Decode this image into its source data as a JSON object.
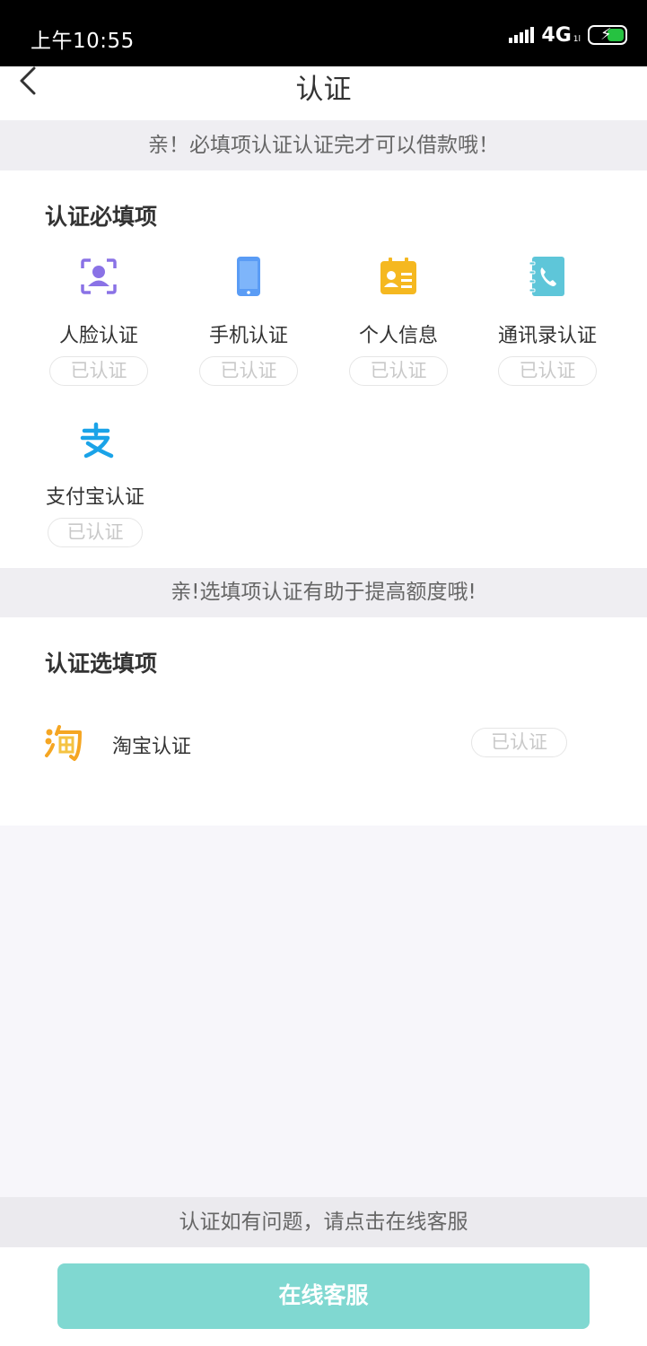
{
  "status_bar": {
    "time": "上午10:55",
    "network": "4G",
    "network_sub": "1l",
    "battery_color": "#26c241"
  },
  "navbar": {
    "title": "认证",
    "back_icon": "chevron-left-icon"
  },
  "required": {
    "banner": "亲！必填项认证认证完才可以借款哦！",
    "title": "认证必填项",
    "items": [
      {
        "label": "人脸认证",
        "status": "已认证",
        "icon": "face-id-icon",
        "color": "#8a72e6"
      },
      {
        "label": "手机认证",
        "status": "已认证",
        "icon": "phone-icon",
        "color": "#5a9cf5"
      },
      {
        "label": "个人信息",
        "status": "已认证",
        "icon": "id-card-icon",
        "color": "#f5b820"
      },
      {
        "label": "通讯录认证",
        "status": "已认证",
        "icon": "contacts-phone-icon",
        "color": "#5ec6d9"
      },
      {
        "label": "支付宝认证",
        "status": "已认证",
        "icon": "alipay-icon",
        "color": "#1aa3e8"
      }
    ]
  },
  "optional": {
    "banner": "亲!选填项认证有助于提高额度哦!",
    "title": "认证选填项",
    "items": [
      {
        "label": "淘宝认证",
        "status": "已认证",
        "icon": "taobao-icon",
        "color": "#f5a623"
      }
    ]
  },
  "footer": {
    "note": "认证如有问题，请点击在线客服",
    "button": "在线客服",
    "button_color": "#80d8d1"
  }
}
